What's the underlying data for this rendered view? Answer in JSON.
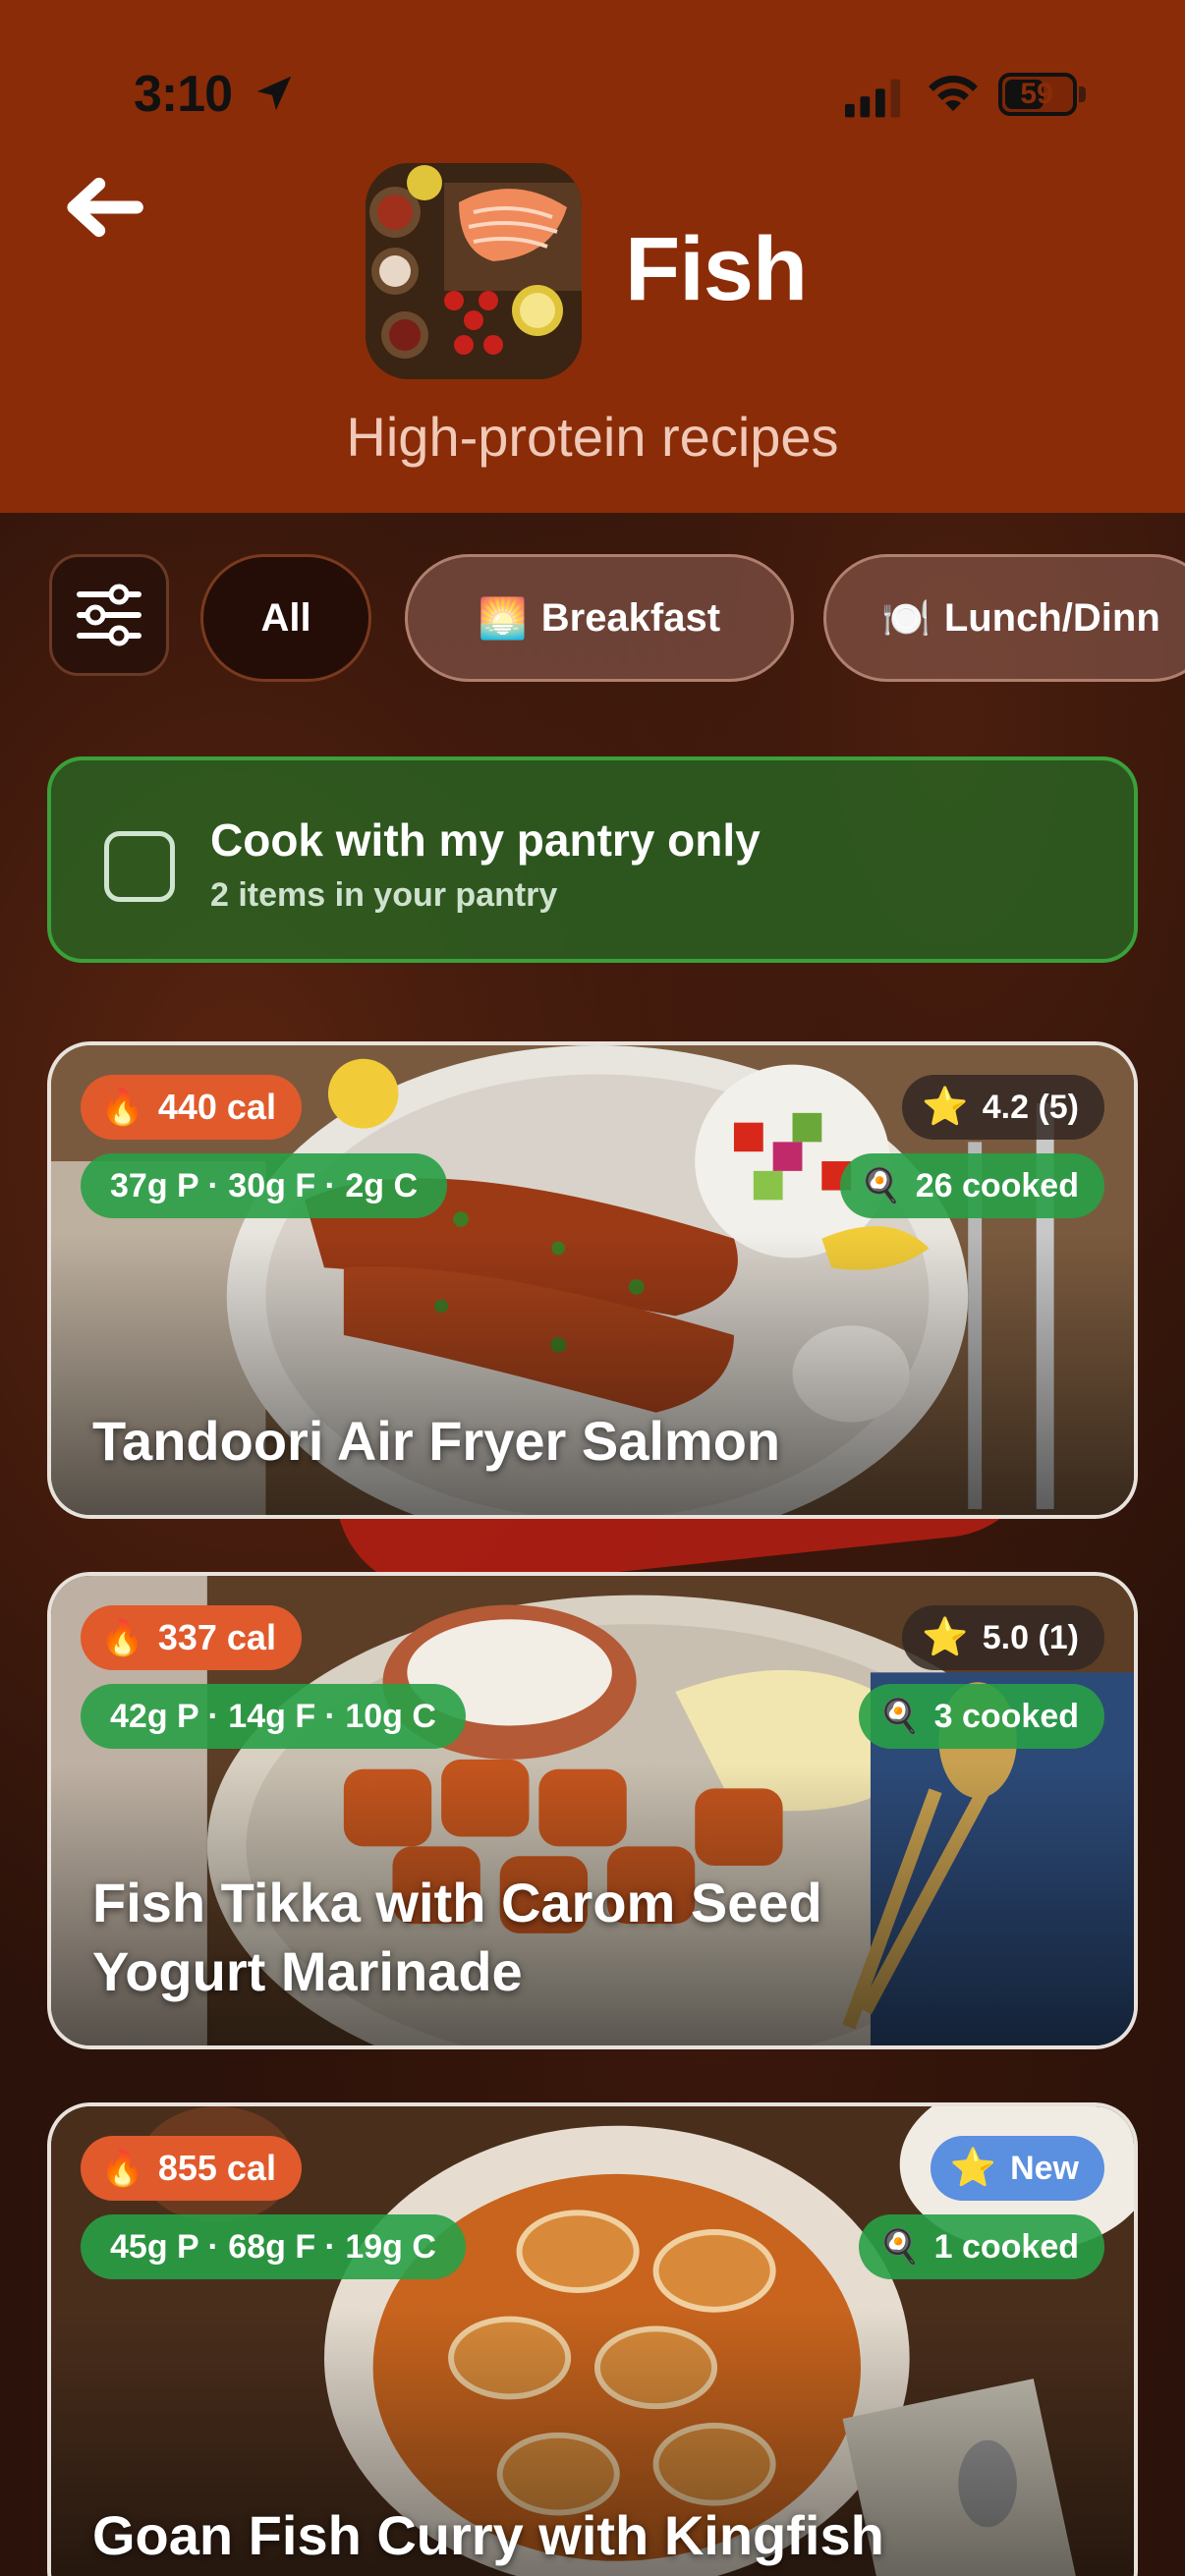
{
  "status_bar": {
    "time": "3:10",
    "battery": "59",
    "battery_level": 0.59
  },
  "header": {
    "title": "Fish",
    "subtitle": "High-protein recipes"
  },
  "filters": {
    "chips": [
      {
        "label": "All",
        "emoji": ""
      },
      {
        "label": "Breakfast",
        "emoji": "🌅"
      },
      {
        "label": "Lunch/Dinn",
        "emoji": "🍽️"
      }
    ]
  },
  "pantry": {
    "title": "Cook with my pantry only",
    "subtitle": "2 items in your pantry"
  },
  "recipes": [
    {
      "name": "Tandoori Air Fryer Salmon",
      "calories": "440 cal",
      "macros": "37g P · 30g F · 2g C",
      "rating": "4.2 (5)",
      "cooked": "26 cooked"
    },
    {
      "name": "Fish Tikka with Carom Seed Yogurt Marinade",
      "calories": "337 cal",
      "macros": "42g P · 14g F · 10g C",
      "rating": "5.0 (1)",
      "cooked": "3 cooked"
    },
    {
      "name": "Goan Fish Curry with Kingfish",
      "calories": "855 cal",
      "macros": "45g P · 68g F · 19g C",
      "rating": "New",
      "cooked": "1 cooked"
    }
  ],
  "icons": {
    "flame": "🔥",
    "star": "⭐",
    "pan": "🍳"
  },
  "colors": {
    "header_bg": "#8a2c08",
    "calorie_badge": "#e05a2c",
    "macro_badge": "#28a046",
    "pantry_bg": "#266e26",
    "new_badge": "#5b8fe0",
    "star": "#ffc928"
  }
}
